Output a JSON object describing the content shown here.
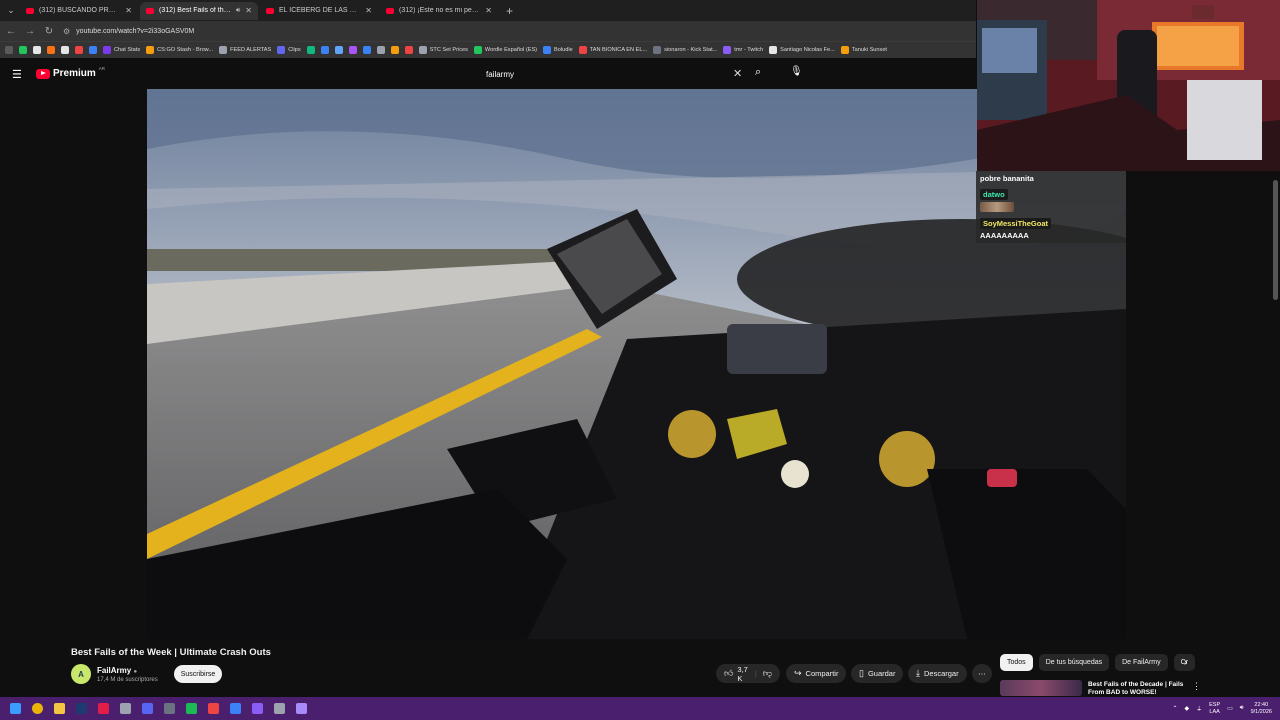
{
  "browser": {
    "tabs": [
      {
        "title": "(312) BUSCANDO PROBLEMAS",
        "active": false
      },
      {
        "title": "(312) Best Fails of the Week",
        "active": true
      },
      {
        "title": "EL ICEBERG DE LAS MUERT*S M",
        "active": false
      },
      {
        "title": "(312) ¡Este no es mi perro, es u",
        "active": false
      }
    ],
    "new_tab_icon": "plus-icon",
    "url": "youtube.com/watch?v=2i33oGASV0M"
  },
  "bookmarks": [
    {
      "label": "",
      "color": "#5b5b5b"
    },
    {
      "label": "",
      "color": "#22c55e"
    },
    {
      "label": "",
      "color": "#e5e5e5"
    },
    {
      "label": "",
      "color": "#f97316"
    },
    {
      "label": "",
      "color": "#e5e5e5"
    },
    {
      "label": "",
      "color": "#ef4444"
    },
    {
      "label": "",
      "color": "#3b82f6"
    },
    {
      "label": "Chat Stats",
      "color": "#7c3aed"
    },
    {
      "label": "CS:GO Stash - Brow...",
      "color": "#f59e0b"
    },
    {
      "label": "FEED ALERTAS",
      "color": "#9ca3af"
    },
    {
      "label": "Clips",
      "color": "#6366f1"
    },
    {
      "label": "",
      "color": "#10b981"
    },
    {
      "label": "",
      "color": "#3b82f6"
    },
    {
      "label": "",
      "color": "#60a5fa"
    },
    {
      "label": "",
      "color": "#a855f7"
    },
    {
      "label": "",
      "color": "#3b82f6"
    },
    {
      "label": "",
      "color": "#9ca3af"
    },
    {
      "label": "",
      "color": "#f59e0b"
    },
    {
      "label": "",
      "color": "#ef4444"
    },
    {
      "label": "STC Set Prices",
      "color": "#9ca3af"
    },
    {
      "label": "Wordle Español (ES)",
      "color": "#22c55e"
    },
    {
      "label": "Boludle",
      "color": "#3b82f6"
    },
    {
      "label": "TAN BIONICA EN EL...",
      "color": "#ef4444"
    },
    {
      "label": "sionaron - Kick Stat...",
      "color": "#6b7280"
    },
    {
      "label": "tmr - Twitch",
      "color": "#8b5cf6"
    },
    {
      "label": "Santiago Nicolas Fe...",
      "color": "#e5e5e5"
    },
    {
      "label": "Tanuki Sunset",
      "color": "#f59e0b"
    }
  ],
  "youtube": {
    "logo_text": "Premium",
    "country_code": "AR",
    "search_value": "failarmy",
    "video_title": "Best Fails of the Week | Ultimate Crash Outs",
    "channel": {
      "name": "FailArmy",
      "subscribers": "17,4 M de suscriptores",
      "avatar_letter": "A",
      "subscribe_label": "Suscribirse"
    },
    "actions": {
      "likes": "3,7 K",
      "share": "Compartir",
      "save": "Guardar",
      "download": "Descargar"
    },
    "chips": [
      "Todos",
      "De tus búsquedas",
      "De FailArmy",
      "Cr"
    ],
    "recommended": {
      "title": "Best Fails of the Decade | Fails From BAD to WORSE!"
    }
  },
  "stream_chat": [
    {
      "user": "",
      "text": "pobre bananita",
      "user_color": "#ffffff"
    },
    {
      "user": "datwo",
      "text": "",
      "user_color": "#3ee6b0",
      "emote": true
    },
    {
      "user": "SoyMessiTheGoat",
      "text": "AAAAAAAAA",
      "user_color": "#f5e663"
    }
  ],
  "taskbar": {
    "apps": [
      {
        "icon": "windows-start-icon",
        "color": "#3b9cff"
      },
      {
        "icon": "chrome-icon",
        "color": "#eab308"
      },
      {
        "icon": "file-explorer-icon",
        "color": "#f5c542"
      },
      {
        "icon": "app-icon",
        "color": "#1f3a6e"
      },
      {
        "icon": "chrome-dev-icon",
        "color": "#e11d48"
      },
      {
        "icon": "obs-icon",
        "color": "#9ca3af"
      },
      {
        "icon": "discord-icon",
        "color": "#5865f2"
      },
      {
        "icon": "app-icon",
        "color": "#6b7280"
      },
      {
        "icon": "spotify-icon",
        "color": "#1db954"
      },
      {
        "icon": "app-icon",
        "color": "#ef4444"
      },
      {
        "icon": "app-icon",
        "color": "#3b82f6"
      },
      {
        "icon": "app-icon",
        "color": "#8b5cf6"
      },
      {
        "icon": "app-icon",
        "color": "#9ca3af"
      },
      {
        "icon": "app-icon",
        "color": "#a78bfa"
      }
    ],
    "lang": "ESP",
    "lang_sub": "LAA",
    "time": "22:40",
    "date": "9/1/2026"
  }
}
